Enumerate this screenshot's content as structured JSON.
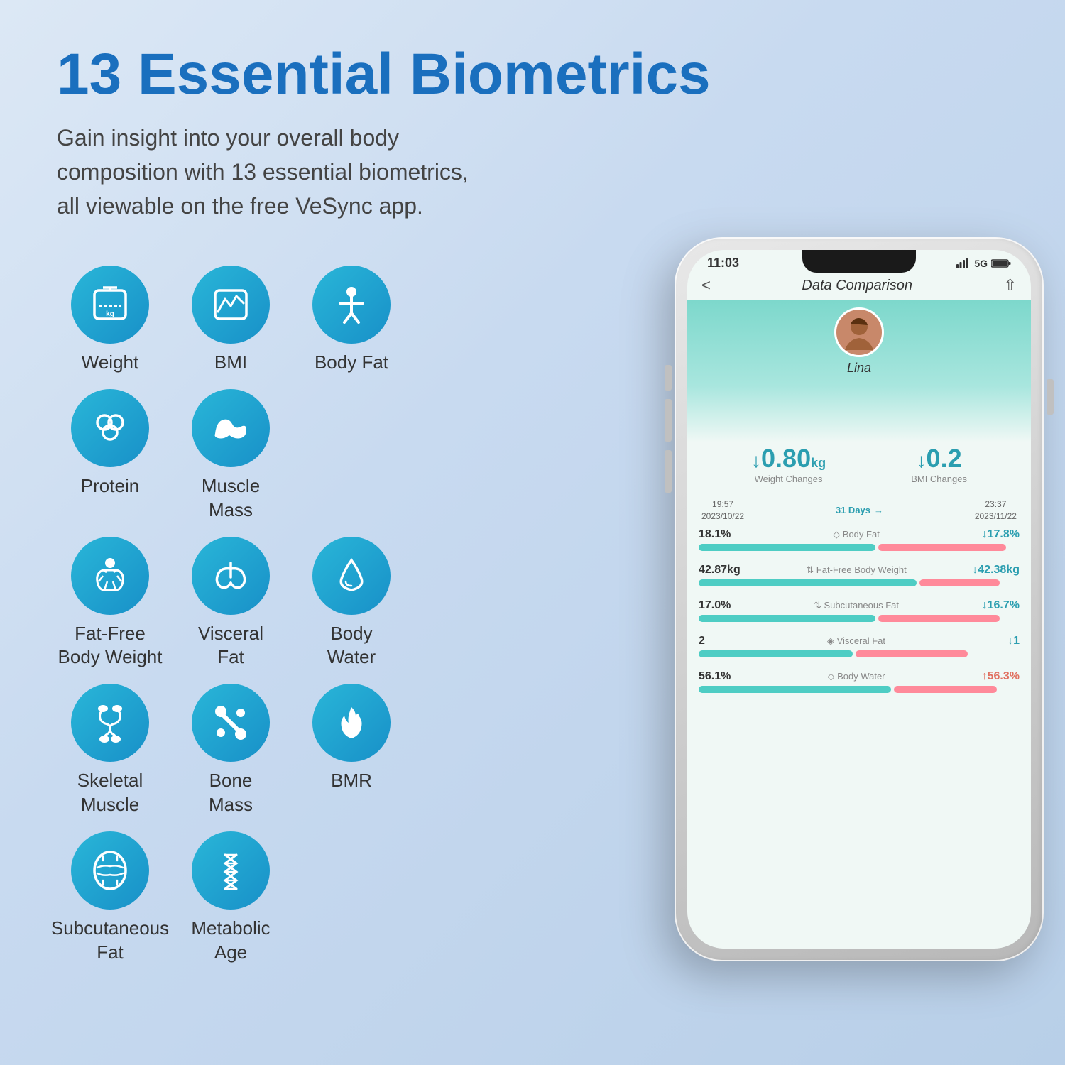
{
  "page": {
    "background": "#c8daf0",
    "headline": "13 Essential Biometrics",
    "subtext": "Gain insight into your overall body composition with 13 essential biometrics, all viewable on the free VeSync app."
  },
  "icons": {
    "row1": [
      {
        "id": "weight",
        "label": "Weight",
        "icon": "scale"
      },
      {
        "id": "bmi",
        "label": "BMI",
        "icon": "heart-wave"
      },
      {
        "id": "body-fat",
        "label": "Body Fat",
        "icon": "body"
      }
    ],
    "row2": [
      {
        "id": "protein",
        "label": "Protein",
        "icon": "molecule"
      },
      {
        "id": "muscle-mass",
        "label": "Muscle Mass",
        "icon": "muscle"
      }
    ],
    "row3": [
      {
        "id": "fat-free",
        "label": "Fat-Free\nBody Weight",
        "icon": "body-lines"
      },
      {
        "id": "visceral-fat",
        "label": "Visceral\nFat",
        "icon": "lungs"
      },
      {
        "id": "body-water",
        "label": "Body\nWater",
        "icon": "drop"
      }
    ],
    "row4": [
      {
        "id": "skeletal-muscle",
        "label": "Skeletal\nMuscle",
        "icon": "arm"
      },
      {
        "id": "bone-mass",
        "label": "Bone\nMass",
        "icon": "bone"
      },
      {
        "id": "bmr",
        "label": "BMR",
        "icon": "flame"
      }
    ],
    "row5": [
      {
        "id": "subcutaneous-fat",
        "label": "Subcutaneous\nFat",
        "icon": "waist"
      },
      {
        "id": "metabolic-age",
        "label": "Metabolic\nAge",
        "icon": "dna"
      }
    ]
  },
  "phone": {
    "status_time": "11:03",
    "status_signal": "5G",
    "status_battery": "100",
    "screen_title": "Data Comparison",
    "user_name": "Lina",
    "weight_change_value": "↓0.80",
    "weight_change_unit": "kg",
    "weight_change_label": "Weight Changes",
    "bmi_change_value": "↓0.2",
    "bmi_change_label": "BMI Changes",
    "date_from": "19:57\n2023/10/22",
    "date_range_label": "31 Days",
    "date_to": "23:37\n2023/11/22",
    "metrics": [
      {
        "left_value": "18.1%",
        "label": "Body Fat",
        "right_value": "↓17.8%",
        "left_bar_width": "65",
        "right_bar_width": "60"
      },
      {
        "left_value": "42.87kg",
        "label": "Fat-Free Body Weight",
        "right_value": "↓42.38kg",
        "left_bar_width": "75",
        "right_bar_width": "70"
      },
      {
        "left_value": "17.0%",
        "label": "Subcutaneous Fat",
        "right_value": "↓16.7%",
        "left_bar_width": "62",
        "right_bar_width": "58"
      },
      {
        "left_value": "2",
        "label": "Visceral Fat",
        "right_value": "↓1",
        "left_bar_width": "55",
        "right_bar_width": "40"
      },
      {
        "left_value": "56.1%",
        "label": "Body Water",
        "right_value": "↑56.3%",
        "left_bar_width": "72",
        "right_bar_width": "74"
      }
    ]
  }
}
